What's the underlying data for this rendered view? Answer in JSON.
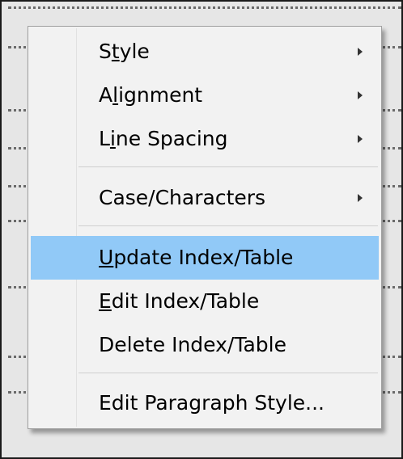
{
  "context_menu": {
    "items": [
      {
        "label": "Style",
        "mnemonic": "t",
        "has_submenu": true
      },
      {
        "label": "Alignment",
        "mnemonic": "l",
        "has_submenu": true
      },
      {
        "label": "Line Spacing",
        "mnemonic": "i",
        "has_submenu": true
      },
      {
        "label": "Case/Characters",
        "mnemonic": "",
        "has_submenu": true
      },
      {
        "label": "Update Index/Table",
        "mnemonic": "U",
        "has_submenu": false,
        "highlighted": true
      },
      {
        "label": "Edit Index/Table",
        "mnemonic": "E",
        "has_submenu": false
      },
      {
        "label": "Delete Index/Table",
        "mnemonic": "",
        "has_submenu": false
      },
      {
        "label": "Edit Paragraph Style...",
        "mnemonic": "",
        "has_submenu": false
      }
    ],
    "highlight_color": "#91c9f7",
    "submenu_icon": "submenu-arrow-icon"
  }
}
